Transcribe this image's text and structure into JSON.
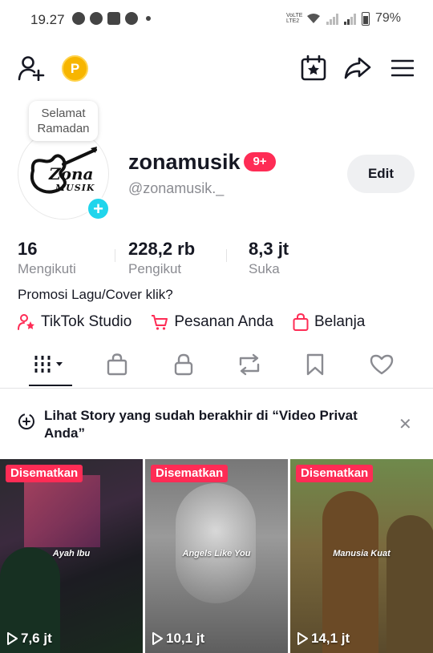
{
  "status_bar": {
    "time": "19.27",
    "network": "VoLTE LTE2",
    "battery": "79%"
  },
  "profile": {
    "bubble": "Selamat Ramadan",
    "avatar_logo": {
      "line1": "Zona",
      "line2": "MUSIK"
    },
    "username": "zonamusik",
    "notif_badge": "9+",
    "handle": "@zonamusik._",
    "edit_label": "Edit"
  },
  "stats": [
    {
      "num": "16",
      "label": "Mengikuti"
    },
    {
      "num": "228,2 rb",
      "label": "Pengikut"
    },
    {
      "num": "8,3 jt",
      "label": "Suka"
    }
  ],
  "bio": "Promosi Lagu/Cover klik?",
  "links": [
    {
      "label": "TikTok Studio",
      "icon": "tiktok-studio-icon"
    },
    {
      "label": "Pesanan Anda",
      "icon": "cart-icon"
    },
    {
      "label": "Belanja",
      "icon": "shopping-bag-icon"
    }
  ],
  "tabs": [
    "videos-grid-icon",
    "shop-bag-icon",
    "lock-icon",
    "repost-icon",
    "bookmark-icon",
    "heart-icon"
  ],
  "story_banner": {
    "text": "Lihat Story yang sudah berakhir di “Video Privat Anda”"
  },
  "videos": [
    {
      "pinned": "Disematkan",
      "caption": "Ayah Ibu",
      "views": "7,6 jt"
    },
    {
      "pinned": "Disematkan",
      "caption": "Angels Like You",
      "views": "10,1 jt"
    },
    {
      "pinned": "Disematkan",
      "caption": "Manusia Kuat",
      "views": "14,1 jt"
    }
  ],
  "colors": {
    "accent": "#fe2c55",
    "plus": "#20d5ec",
    "coin": "#f7b500"
  }
}
